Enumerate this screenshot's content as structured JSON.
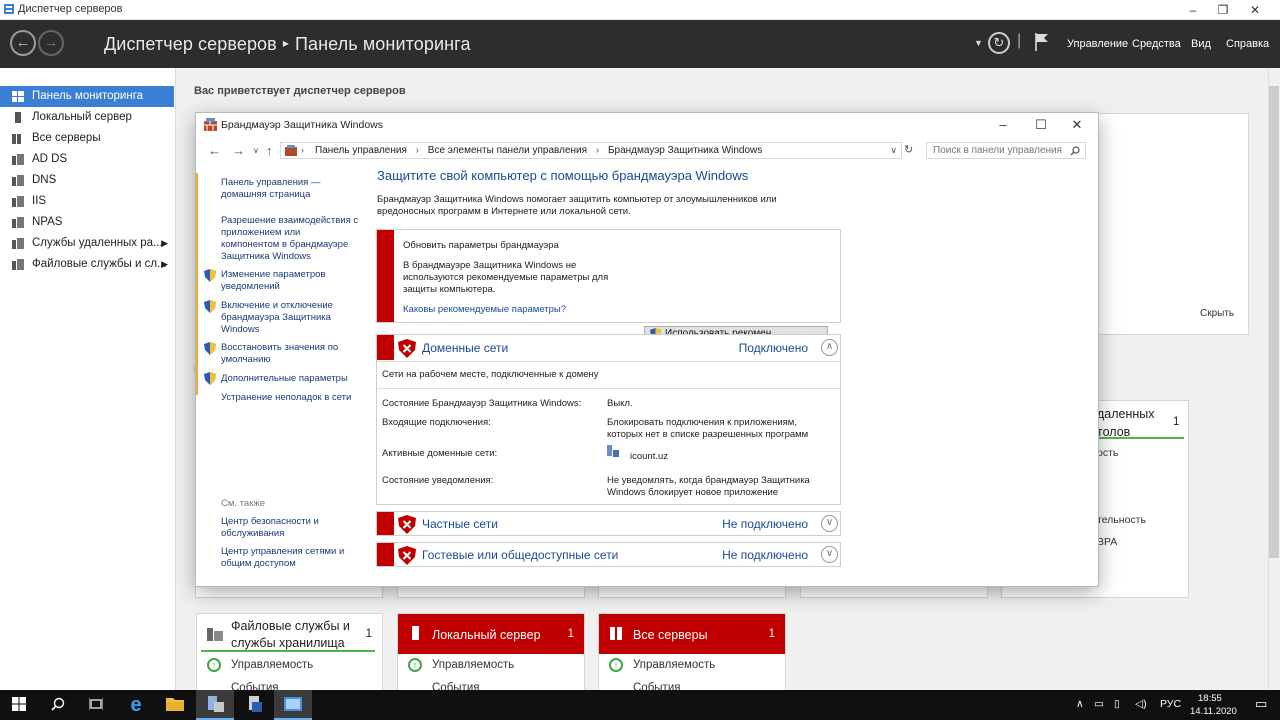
{
  "window": {
    "title": "Диспетчер серверов"
  },
  "header": {
    "breadcrumb_root": "Диспетчер серверов",
    "breadcrumb_sep": "▸",
    "breadcrumb_page": "Панель мониторинга",
    "menu": [
      "Управление",
      "Средства",
      "Вид",
      "Справка"
    ]
  },
  "sidebar": {
    "items": [
      {
        "label": "Панель мониторинга",
        "icon": "dashboard-icon",
        "active": true
      },
      {
        "label": "Локальный сервер",
        "icon": "server-icon"
      },
      {
        "label": "Все серверы",
        "icon": "servers-icon"
      },
      {
        "label": "AD DS",
        "icon": "role-icon"
      },
      {
        "label": "DNS",
        "icon": "role-icon"
      },
      {
        "label": "IIS",
        "icon": "role-icon"
      },
      {
        "label": "NPAS",
        "icon": "role-icon"
      },
      {
        "label": "Службы удаленных ра...",
        "icon": "role-icon",
        "expand": true
      },
      {
        "label": "Файловые службы и сл...",
        "icon": "role-icon",
        "expand": true
      }
    ]
  },
  "main": {
    "welcome": "Вас приветствует диспетчер серверов",
    "hide_label": "Скрыть",
    "partial_texts": {
      "remote_title": "даленных\nтолов",
      "remote_count": "1",
      "t1": "ость",
      "t2": "тельность",
      "t3": "BPA",
      "r": "Р"
    },
    "tiles": [
      {
        "title": "Файловые службы и службы хранилища",
        "count": "1",
        "red": false,
        "rows": [
          "Управляемость",
          "События"
        ]
      },
      {
        "title": "Локальный сервер",
        "count": "1",
        "red": true,
        "rows": [
          "Управляемость",
          "События"
        ]
      },
      {
        "title": "Все серверы",
        "count": "1",
        "red": true,
        "rows": [
          "Управляемость",
          "События"
        ]
      }
    ]
  },
  "firewall": {
    "title": "Брандмауэр Защитника Windows",
    "address": [
      "Панель управления",
      "Все элементы панели управления",
      "Брандмауэр Защитника Windows"
    ],
    "address_sep": "›",
    "search_placeholder": "Поиск в панели управления",
    "left_links": [
      {
        "text": "Панель управления — домашняя страница",
        "shield": false
      },
      {
        "text": "Разрешение взаимодействия с приложением или компонентом в брандмауэре Защитника Windows",
        "shield": false
      },
      {
        "text": "Изменение параметров уведомлений",
        "shield": true
      },
      {
        "text": "Включение и отключение брандмауэра Защитника Windows",
        "shield": true
      },
      {
        "text": "Восстановить значения по умолчанию",
        "shield": true
      },
      {
        "text": "Дополнительные параметры",
        "shield": true
      },
      {
        "text": "Устранение неполадок в сети",
        "shield": false
      }
    ],
    "see_also": "См. также",
    "see_also_links": [
      "Центр безопасности и обслуживания",
      "Центр управления сетями и общим доступом"
    ],
    "heading": "Защитите свой компьютер с помощью брандмауэра Windows",
    "description": "Брандмауэр Защитника Windows помогает защитить компьютер от злоумышленников или вредоносных программ в Интернете или локальной сети.",
    "warning": {
      "title": "Обновить параметры брандмауэра",
      "text": "В брандмауэре Защитника Windows не используются рекомендуемые параметры для защиты компьютера.",
      "button": "Использовать рекомен. параметры",
      "link": "Каковы рекомендуемые параметры?"
    },
    "domain": {
      "name": "Доменные сети",
      "status": "Подключено",
      "subtitle": "Сети на рабочем месте, подключенные к домену",
      "rows": [
        {
          "k": "Состояние Брандмауэр Защитника Windows:",
          "v": "Выкл."
        },
        {
          "k": "Входящие подключения:",
          "v": "Блокировать подключения к приложениям, которых нет в списке разрешенных программ"
        },
        {
          "k": "Активные доменные сети:",
          "v": "icount.uz"
        },
        {
          "k": "Состояние уведомления:",
          "v": "Не уведомлять, когда брандмауэр Защитника Windows блокирует новое приложение"
        }
      ]
    },
    "private": {
      "name": "Частные сети",
      "status": "Не подключено"
    },
    "guest": {
      "name": "Гостевые или общедоступные сети",
      "status": "Не подключено"
    }
  },
  "taskbar": {
    "lang": "РУС",
    "time": "18:55",
    "date": "14.11.2020"
  },
  "colors": {
    "accent": "#3a7fd4",
    "alert": "#c00000",
    "ok": "#4db54d",
    "header": "#2d2d2d"
  }
}
